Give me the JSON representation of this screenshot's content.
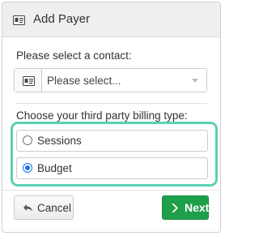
{
  "dialog": {
    "title": "Add Payer",
    "title_icon": "id-card-icon"
  },
  "contact": {
    "label": "Please select a contact:",
    "select_placeholder": "Please select...",
    "addon_icon": "id-card-icon"
  },
  "billing": {
    "label": "Choose your third party billing type:",
    "options": [
      {
        "label": "Sessions",
        "selected": false
      },
      {
        "label": "Budget",
        "selected": true
      }
    ],
    "highlight_color": "#5cd1b4"
  },
  "footer": {
    "cancel_label": "Cancel",
    "cancel_icon": "undo-arrow-icon",
    "next_label": "Next",
    "next_icon": "chevron-right-icon",
    "next_color": "#1e9f4a"
  }
}
